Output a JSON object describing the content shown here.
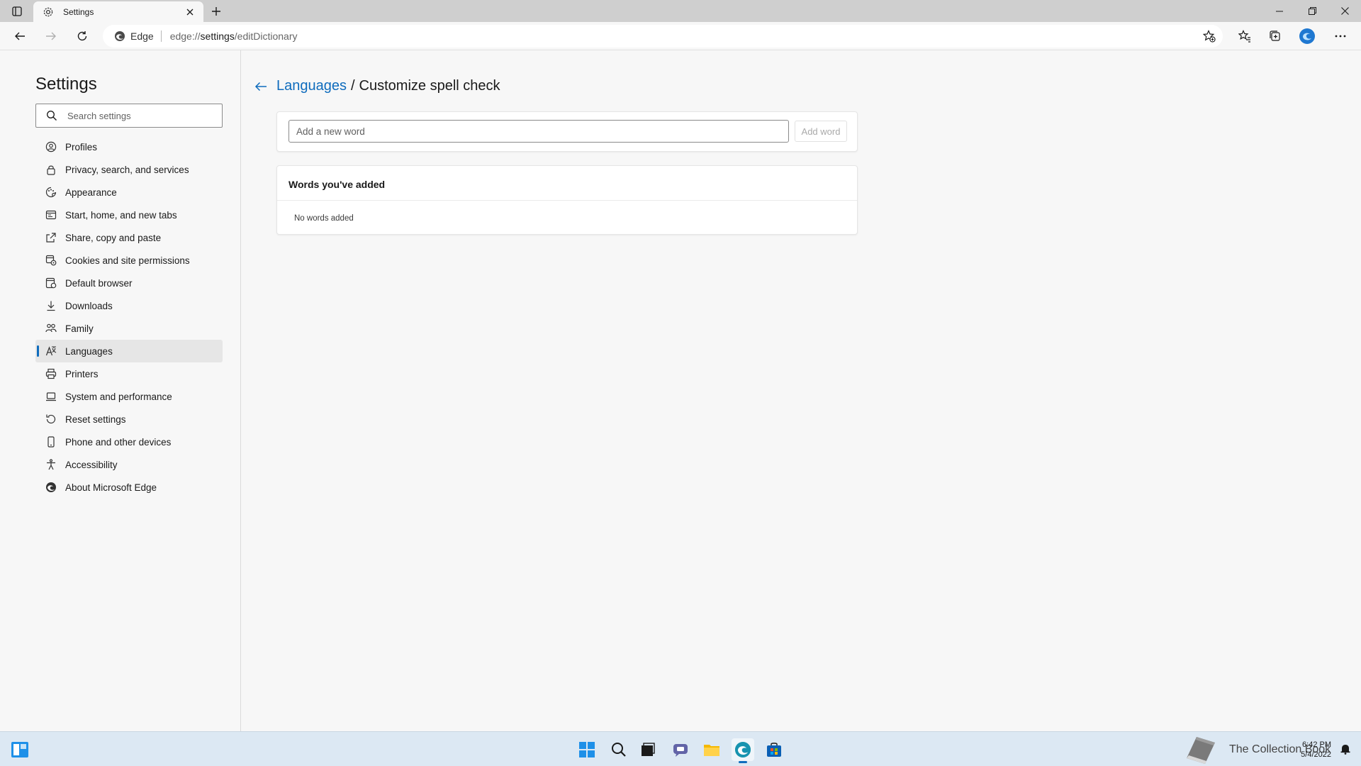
{
  "browser": {
    "tab_title": "Settings",
    "site_label": "Edge",
    "url_prefix": "edge://",
    "url_main": "settings",
    "url_suffix": "/editDictionary",
    "accent": "#0f6cbd"
  },
  "sidebar": {
    "title": "Settings",
    "search_placeholder": "Search settings",
    "items": [
      {
        "label": "Profiles",
        "icon": "profile-icon"
      },
      {
        "label": "Privacy, search, and services",
        "icon": "lock-icon"
      },
      {
        "label": "Appearance",
        "icon": "appearance-icon"
      },
      {
        "label": "Start, home, and new tabs",
        "icon": "start-icon"
      },
      {
        "label": "Share, copy and paste",
        "icon": "share-icon"
      },
      {
        "label": "Cookies and site permissions",
        "icon": "cookies-icon"
      },
      {
        "label": "Default browser",
        "icon": "default-browser-icon"
      },
      {
        "label": "Downloads",
        "icon": "download-icon"
      },
      {
        "label": "Family",
        "icon": "family-icon"
      },
      {
        "label": "Languages",
        "icon": "languages-icon",
        "active": true
      },
      {
        "label": "Printers",
        "icon": "printer-icon"
      },
      {
        "label": "System and performance",
        "icon": "laptop-icon"
      },
      {
        "label": "Reset settings",
        "icon": "reset-icon"
      },
      {
        "label": "Phone and other devices",
        "icon": "phone-icon"
      },
      {
        "label": "Accessibility",
        "icon": "accessibility-icon"
      },
      {
        "label": "About Microsoft Edge",
        "icon": "edge-icon"
      }
    ]
  },
  "main": {
    "breadcrumb_parent": "Languages",
    "breadcrumb_separator": "/",
    "breadcrumb_current": "Customize spell check",
    "word_input_placeholder": "Add a new word",
    "word_input_value": "",
    "add_word_label": "Add word",
    "words_heading": "Words you've added",
    "empty_message": "No words added"
  },
  "taskbar": {
    "tray_overlay_text": "The Collection Book",
    "time": "6:42 PM",
    "date": "5/4/2022"
  }
}
